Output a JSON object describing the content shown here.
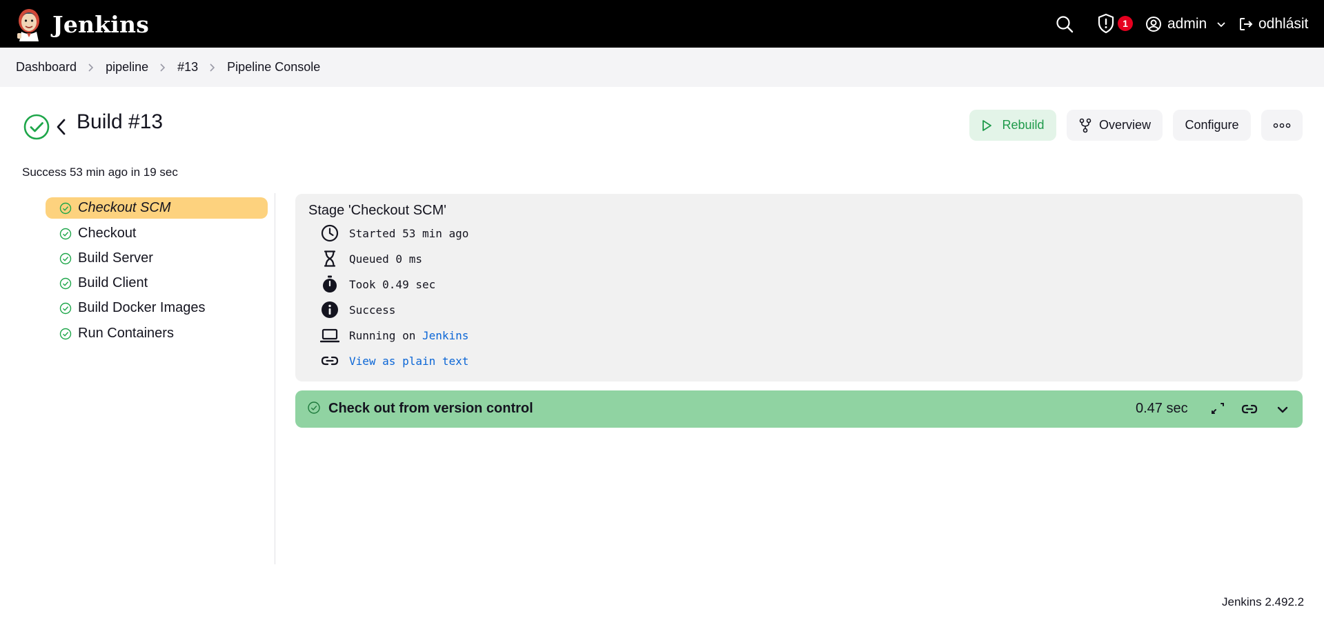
{
  "header": {
    "app_name": "Jenkins",
    "notifications_count": "1",
    "user_name": "admin",
    "logout_label": "odhlásit"
  },
  "breadcrumb": [
    "Dashboard",
    "pipeline",
    "#13",
    "Pipeline Console"
  ],
  "build": {
    "title": "Build #13",
    "summary": "Success 53 min ago in 19 sec",
    "status_color": "#1ea64a"
  },
  "actions": {
    "rebuild": "Rebuild",
    "overview": "Overview",
    "configure": "Configure"
  },
  "stages": [
    {
      "label": "Checkout SCM",
      "active": true
    },
    {
      "label": "Checkout",
      "active": false
    },
    {
      "label": "Build Server",
      "active": false
    },
    {
      "label": "Build Client",
      "active": false
    },
    {
      "label": "Build Docker Images",
      "active": false
    },
    {
      "label": "Run Containers",
      "active": false
    }
  ],
  "stage_details": {
    "title": "Stage 'Checkout SCM'",
    "started": "Started 53 min ago",
    "queued": "Queued 0 ms",
    "took": "Took 0.49 sec",
    "status": "Success",
    "running_on_prefix": "Running on",
    "running_on_node": "Jenkins",
    "plain_text_link": "View as plain text"
  },
  "step": {
    "title": "Check out from version control",
    "duration": "0.47 sec",
    "bar_color": "#90d3a2"
  },
  "footer": {
    "version": "Jenkins 2.492.2"
  },
  "colors": {
    "active_stage": "#fdd27e",
    "link": "#0b66d6",
    "badge": "#e6001f"
  }
}
